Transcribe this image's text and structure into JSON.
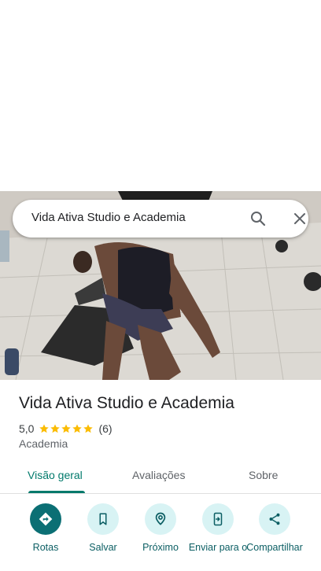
{
  "search": {
    "query": "Vida Ativa Studio e Academia"
  },
  "place": {
    "title": "Vida Ativa Studio e Academia",
    "rating": "5,0",
    "stars": 5,
    "review_count": "(6)",
    "category": "Academia"
  },
  "tabs": [
    {
      "label": "Visão geral",
      "active": true
    },
    {
      "label": "Avaliações",
      "active": false
    },
    {
      "label": "Sobre",
      "active": false
    }
  ],
  "actions": [
    {
      "label": "Rotas",
      "icon": "directions-icon"
    },
    {
      "label": "Salvar",
      "icon": "bookmark-icon"
    },
    {
      "label": "Próximo",
      "icon": "nearby-icon"
    },
    {
      "label": "Enviar para o",
      "icon": "send-to-phone-icon"
    },
    {
      "label": "Compartilhar",
      "icon": "share-icon"
    }
  ],
  "colors": {
    "accent": "#00796b",
    "action_bg": "#d8f3f4",
    "primary_action": "#0b6f74",
    "star": "#fbbc04"
  }
}
